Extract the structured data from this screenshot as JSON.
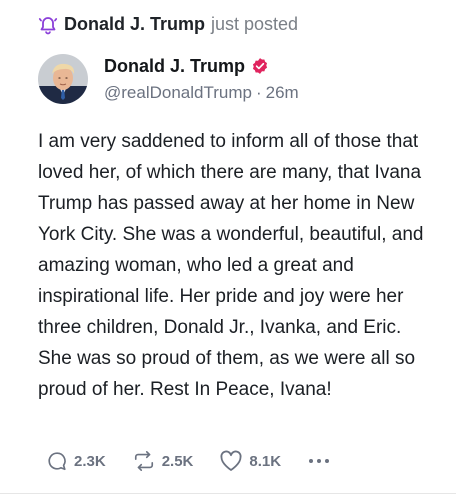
{
  "notice": {
    "icon": "bell-icon",
    "author": "Donald J. Trump",
    "verb": "just posted"
  },
  "author": {
    "display_name": "Donald J. Trump",
    "handle": "@realDonaldTrump",
    "separator": "·",
    "age": "26m",
    "verified_color": "#e0245e"
  },
  "post": {
    "text": "I am very saddened to inform all of those that loved her, of which there are many, that Ivana Trump has passed away at her home in New York City. She was a wonderful, beautiful, and amazing woman, who led a great and inspirational life. Her pride and joy were her three children, Donald Jr., Ivanka, and Eric. She was so proud of them, as we were all so proud of her. Rest In Peace, Ivana!"
  },
  "actions": {
    "replies": "2.3K",
    "reposts": "2.5K",
    "likes": "8.1K"
  }
}
